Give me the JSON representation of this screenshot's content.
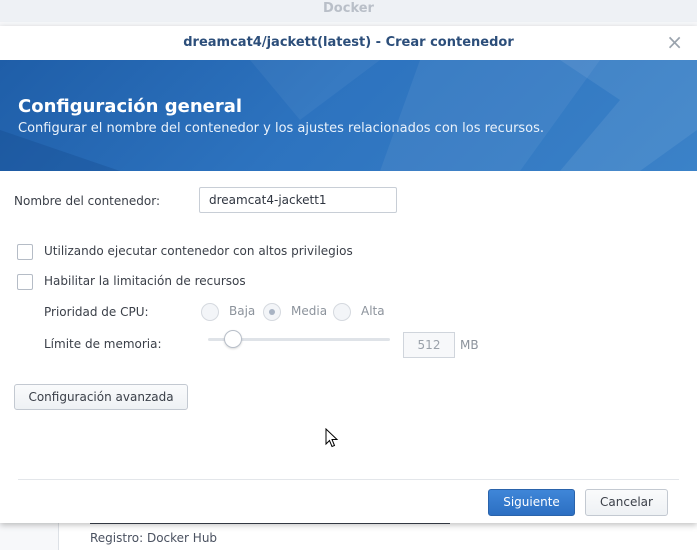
{
  "background": {
    "window_title": "Docker",
    "registry_text": "Registro: Docker Hub"
  },
  "modal": {
    "title": "dreamcat4/jackett(latest) - Crear contenedor",
    "close_glyph": "×"
  },
  "banner": {
    "title": "Configuración general",
    "subtitle": "Configurar el nombre del contenedor y los ajustes relacionados con los recursos."
  },
  "form": {
    "name_label": "Nombre del contenedor:",
    "name_value": "dreamcat4-jackett1",
    "privileged_label": "Utilizando ejecutar contenedor con altos privilegios",
    "limit_label": "Habilitar la limitación de recursos",
    "cpu_label": "Prioridad de CPU:",
    "cpu_options": [
      "Baja",
      "Media",
      "Alta"
    ],
    "cpu_selected": "Media",
    "memory_label": "Límite de memoria:",
    "memory_value": "512",
    "memory_unit": "MB",
    "advanced_button": "Configuración avanzada"
  },
  "footer": {
    "next_button": "Siguiente",
    "cancel_button": "Cancelar"
  },
  "colors": {
    "banner": "#2d6db8",
    "primary_button": "#3577c9",
    "title_text": "#2c4e7a"
  }
}
